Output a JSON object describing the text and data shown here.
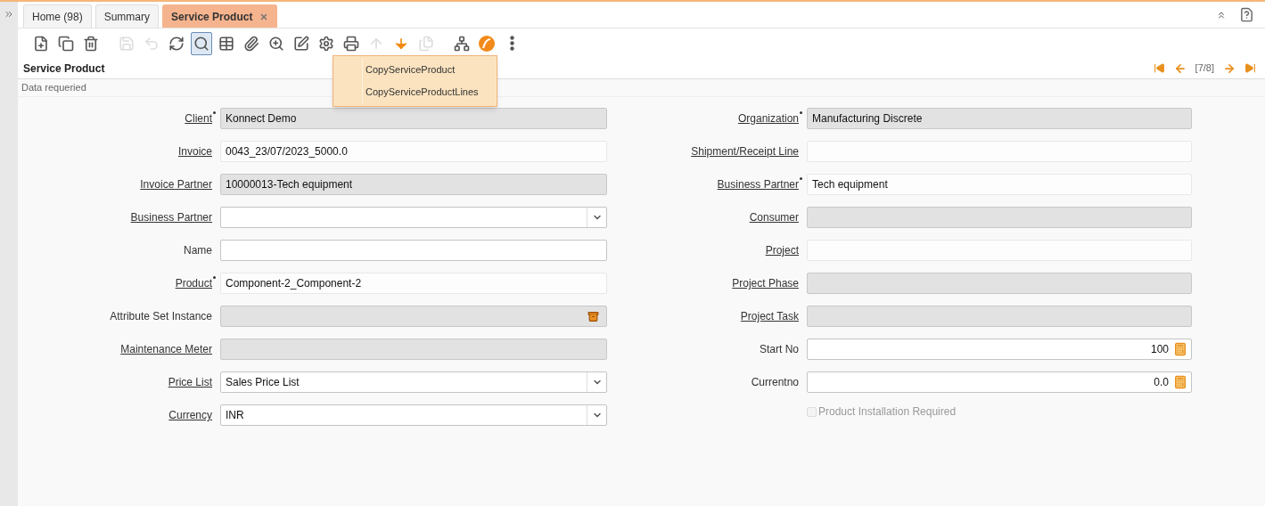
{
  "tabs": [
    {
      "label": "Home (98)",
      "selected": false,
      "closable": false
    },
    {
      "label": "Summary",
      "selected": false,
      "closable": false
    },
    {
      "label": "Service Product",
      "selected": true,
      "closable": true
    }
  ],
  "toolbar": [
    {
      "enabled": true,
      "pressed": false
    },
    {
      "enabled": true,
      "pressed": false
    },
    {
      "enabled": true,
      "pressed": false
    },
    {
      "enabled": false,
      "pressed": false
    },
    {
      "enabled": false,
      "pressed": false
    },
    {
      "enabled": true,
      "pressed": false
    },
    {
      "enabled": true,
      "pressed": true
    },
    {
      "enabled": true,
      "pressed": false
    },
    {
      "enabled": true,
      "pressed": false
    },
    {
      "enabled": true,
      "pressed": false
    },
    {
      "enabled": true,
      "pressed": false
    },
    {
      "enabled": true,
      "pressed": false
    },
    {
      "enabled": true,
      "pressed": false
    },
    {
      "enabled": false,
      "pressed": false
    },
    {
      "enabled": true,
      "pressed": false
    },
    {
      "enabled": false,
      "pressed": false
    },
    {
      "enabled": true,
      "pressed": false
    },
    {
      "enabled": true,
      "pressed": false
    },
    {
      "enabled": true,
      "pressed": false
    }
  ],
  "process_menu": [
    "CopyServiceProduct",
    "CopyServiceProductLines"
  ],
  "header": {
    "title": "Service Product",
    "record": "[7/8]"
  },
  "status": "Data requeried",
  "left_fields": [
    {
      "label": "Client",
      "link": true,
      "mandatory": true,
      "kind": "text",
      "editable": false,
      "greyed": true,
      "value": "Konnect Demo"
    },
    {
      "label": "Invoice",
      "link": true,
      "mandatory": false,
      "kind": "text",
      "editable": false,
      "greyed": false,
      "value": "0043_23/07/2023_5000.0"
    },
    {
      "label": "Invoice Partner",
      "link": true,
      "mandatory": false,
      "kind": "text",
      "editable": false,
      "greyed": true,
      "value": "10000013-Tech equipment"
    },
    {
      "label": "Business Partner",
      "link": true,
      "mandatory": false,
      "kind": "combo",
      "editable": true,
      "greyed": false
    },
    {
      "label": "Name",
      "link": false,
      "mandatory": false,
      "kind": "text",
      "editable": true,
      "greyed": false
    },
    {
      "label": "Product",
      "link": true,
      "mandatory": true,
      "kind": "text",
      "editable": false,
      "greyed": false,
      "value": "Component-2_Component-2"
    },
    {
      "label": "Attribute Set Instance",
      "link": false,
      "mandatory": false,
      "kind": "attribute",
      "editable": false,
      "greyed": true
    },
    {
      "label": "Maintenance Meter",
      "link": true,
      "mandatory": false,
      "kind": "text",
      "editable": false,
      "greyed": true
    },
    {
      "label": "Price List",
      "link": true,
      "mandatory": false,
      "kind": "combo",
      "editable": true,
      "greyed": false,
      "value": "Sales Price List"
    },
    {
      "label": "Currency",
      "link": true,
      "mandatory": false,
      "kind": "combo",
      "editable": true,
      "greyed": false,
      "value": "INR"
    }
  ],
  "right_fields": [
    {
      "label": "Organization",
      "link": true,
      "mandatory": true,
      "kind": "text",
      "editable": false,
      "greyed": true,
      "value": "Manufacturing Discrete"
    },
    {
      "label": "Shipment/Receipt Line",
      "link": true,
      "mandatory": false,
      "kind": "text",
      "editable": false,
      "greyed": false
    },
    {
      "label": "Business Partner",
      "link": true,
      "mandatory": true,
      "kind": "text",
      "editable": false,
      "greyed": false,
      "value": "Tech equipment"
    },
    {
      "label": "Consumer",
      "link": true,
      "mandatory": false,
      "kind": "text",
      "editable": false,
      "greyed": true
    },
    {
      "label": "Project",
      "link": true,
      "mandatory": false,
      "kind": "text",
      "editable": false,
      "greyed": false
    },
    {
      "label": "Project Phase",
      "link": true,
      "mandatory": false,
      "kind": "text",
      "editable": false,
      "greyed": true
    },
    {
      "label": "Project Task",
      "link": true,
      "mandatory": false,
      "kind": "text",
      "editable": false,
      "greyed": true
    },
    {
      "label": "Start No",
      "link": false,
      "mandatory": false,
      "kind": "number",
      "editable": true,
      "greyed": false,
      "value": "100"
    },
    {
      "label": "Currentno",
      "link": false,
      "mandatory": false,
      "kind": "number",
      "editable": true,
      "greyed": false,
      "value": "0.0"
    }
  ],
  "checkbox": {
    "label": "Product Installation Required",
    "checked": false,
    "disabled": true
  }
}
